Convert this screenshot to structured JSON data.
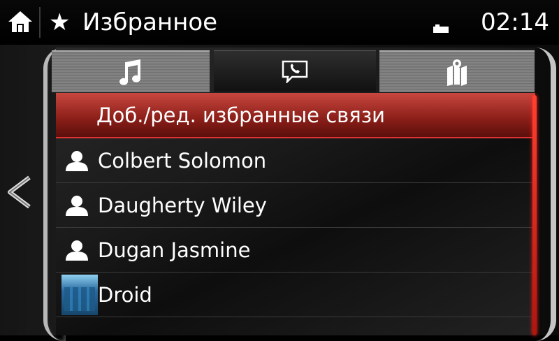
{
  "header": {
    "star": "★",
    "title": "Избранное",
    "clock": "02:14"
  },
  "tabs": [
    {
      "icon": "music-note-icon",
      "active": false
    },
    {
      "icon": "phone-message-icon",
      "active": true
    },
    {
      "icon": "map-pin-icon",
      "active": false
    }
  ],
  "list": {
    "add_edit_label": "Доб./ред. избранные связи",
    "contacts": [
      {
        "name": "Colbert Solomon",
        "icon": "person-icon"
      },
      {
        "name": "Daugherty Wiley",
        "icon": "person-icon"
      },
      {
        "name": "Dugan Jasmine",
        "icon": "person-icon"
      },
      {
        "name": "Droid",
        "icon": "device-thumbnail"
      }
    ]
  },
  "colors": {
    "accent_red": "#c8473f",
    "scroll_red": "#ff4030"
  }
}
